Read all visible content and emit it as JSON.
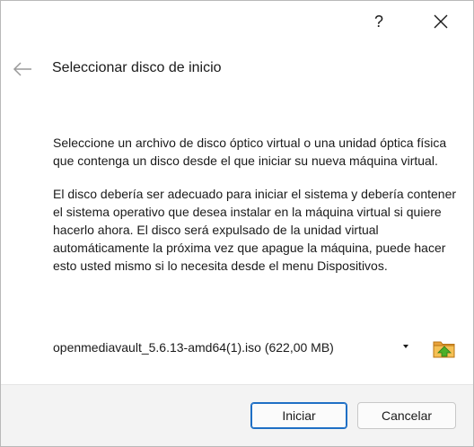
{
  "titlebar": {
    "help_label": "?",
    "close_icon": "close-icon"
  },
  "header": {
    "back_icon": "arrow-left-icon",
    "title": "Seleccionar disco de inicio"
  },
  "content": {
    "paragraph1": "Seleccione un archivo de disco óptico virtual o una unidad óptica física que contenga un disco desde el que iniciar su nueva máquina virtual.",
    "paragraph2": "El disco debería ser adecuado para iniciar el sistema y debería contener el sistema operativo que desea instalar en la máquina virtual si quiere hacerlo ahora. El disco será expulsado de la unidad virtual automáticamente la próxima vez que apague la máquina, puede hacer esto usted mismo si lo necesita desde el menu Dispositivos."
  },
  "disk_select": {
    "selected": "openmediavault_5.6.13-amd64(1).iso (622,00 MB)",
    "folder_icon": "folder-up-icon"
  },
  "footer": {
    "start_label": "Iniciar",
    "cancel_label": "Cancelar"
  },
  "colors": {
    "primary_border": "#1f6fc5",
    "footer_bg": "#f3f3f3",
    "folder_orange": "#e8a23a",
    "folder_green": "#4caf2a"
  }
}
